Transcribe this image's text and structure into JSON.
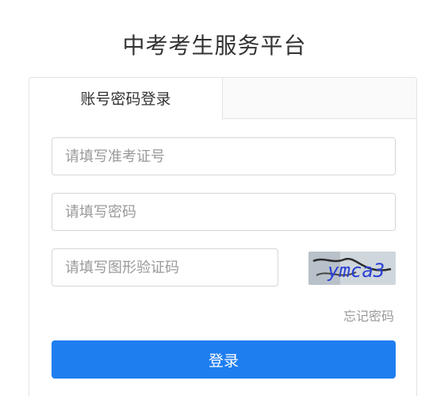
{
  "page": {
    "title": "中考考生服务平台"
  },
  "tabs": [
    {
      "label": "账号密码登录",
      "active": true
    }
  ],
  "form": {
    "exam_id_placeholder": "请填写准考证号",
    "password_placeholder": "请填写密码",
    "captcha_placeholder": "请填写图形验证码",
    "captcha_text": "ymca3",
    "forgot_label": "忘记密码",
    "login_label": "登录"
  },
  "colors": {
    "primary": "#1e7ef0",
    "captcha_text": "#2a3fd6"
  }
}
